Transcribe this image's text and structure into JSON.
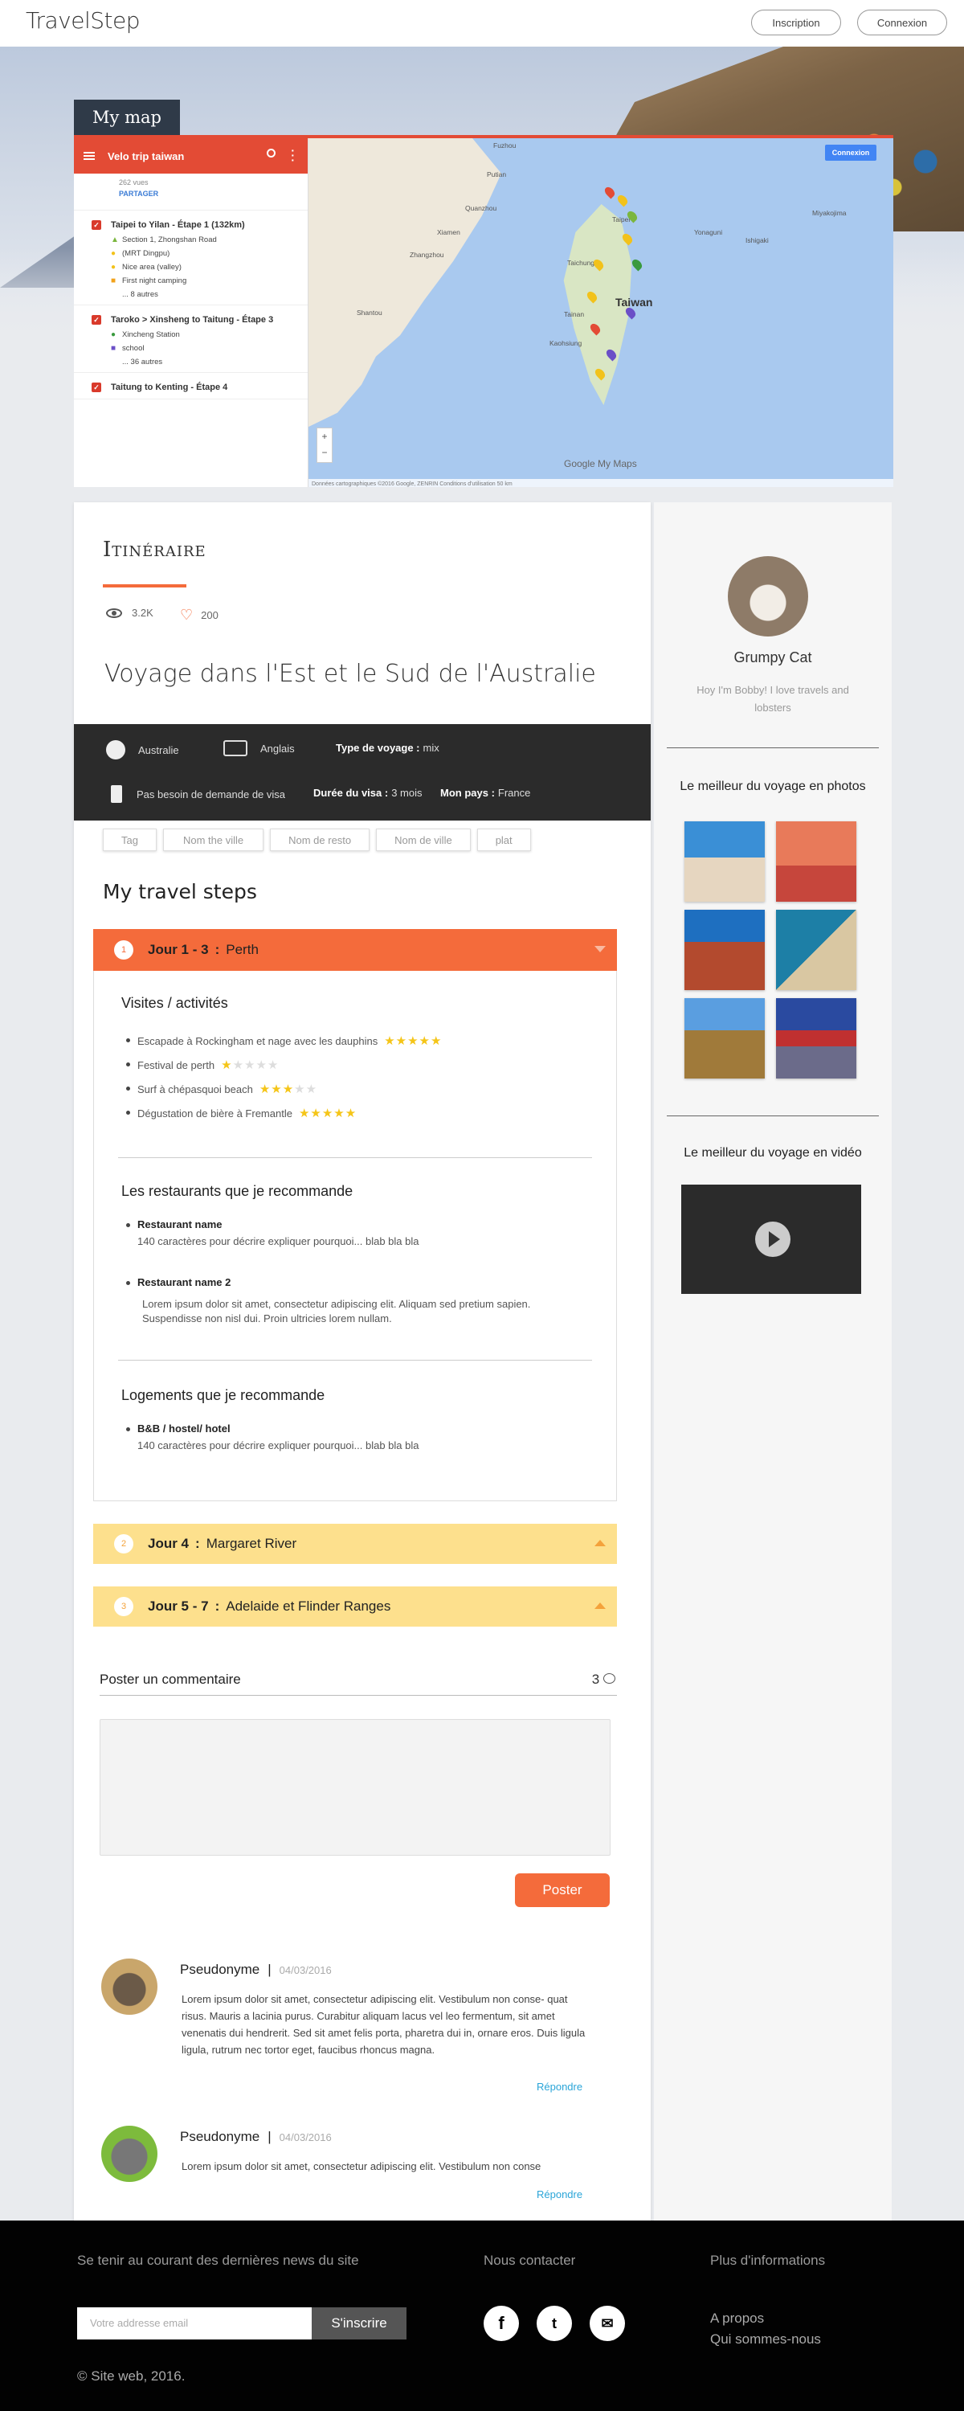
{
  "header": {
    "logo": "TravelStep",
    "signup": "Inscription",
    "login": "Connexion"
  },
  "map": {
    "tab_label": "My map",
    "title": "Velo trip taiwan",
    "views": "262 vues",
    "share": "PARTAGER",
    "connect_label": "Connexion",
    "footer_text": "Données cartographiques ©2016 Google, ZENRIN   Conditions d'utilisation   50 km",
    "brand": "Google My Maps",
    "layers": [
      {
        "title": "Taipei to Yilan - Étape 1 (132km)",
        "items": [
          "Section 1, Zhongshan Road",
          "(MRT Dingpu)",
          "Nice area (valley)",
          "First night camping",
          "... 8 autres"
        ]
      },
      {
        "title": "Taroko > Xinsheng to Taitung - Étape 3",
        "items": [
          "Xincheng Station",
          "school",
          "... 36 autres"
        ]
      },
      {
        "title": "Taitung to Kenting - Étape 4",
        "items": []
      }
    ],
    "places": [
      "Fuzhou",
      "Putian",
      "Quanzhou",
      "Xiamen",
      "Zhangzhou",
      "Shantou",
      "Taipei",
      "Taichung",
      "Tainan",
      "Kaohsiung",
      "Taiwan",
      "Miyakojima",
      "Ishigaki",
      "Yonaguni"
    ]
  },
  "itinerary": {
    "heading": "Itinéraire",
    "views": "3.2K",
    "likes": "200",
    "title": "Voyage dans l'Est et le Sud de l'Australie",
    "country": "Australie",
    "language": "Anglais",
    "trip_type_label": "Type de voyage :",
    "trip_type": "mix",
    "visa": "Pas besoin de demande de visa",
    "visa_duration_label": "Durée du visa :",
    "visa_duration": "3 mois",
    "home_label": "Mon pays :",
    "home": "France",
    "tags": [
      "Tag",
      "Nom the ville",
      "Nom de resto",
      "Nom de ville",
      "plat"
    ]
  },
  "steps": {
    "heading": "My travel steps",
    "items": [
      {
        "num": "1",
        "days": "Jour 1 - 3",
        "sep": ":",
        "place": "Perth"
      },
      {
        "num": "2",
        "days": "Jour 4",
        "sep": ":",
        "place": "Margaret River"
      },
      {
        "num": "3",
        "days": "Jour 5 - 7",
        "sep": ":",
        "place": "Adelaide et Flinder Ranges"
      }
    ],
    "activities_heading": "Visites / activités",
    "activities": [
      {
        "label": "Escapade à Rockingham et nage avec les dauphins",
        "rating": 5
      },
      {
        "label": "Festival de perth",
        "rating": 1
      },
      {
        "label": "Surf à chépasquoi beach",
        "rating": 3
      },
      {
        "label": "Dégustation de bière à Fremantle",
        "rating": 5
      }
    ],
    "restaurants_heading": "Les restaurants que je recommande",
    "restaurants": [
      {
        "name": "Restaurant name",
        "desc": "140 caractères pour décrire expliquer pourquoi... blab bla bla"
      },
      {
        "name": "Restaurant name 2",
        "desc": "Lorem ipsum dolor sit amet, consectetur adipiscing elit. Aliquam sed pretium sapien. Suspendisse non nisl dui. Proin ultricies lorem nullam."
      }
    ],
    "lodging_heading": "Logements que je recommande",
    "lodging": {
      "name": "B&B / hostel/ hotel",
      "desc": "140 caractères pour décrire expliquer pourquoi... blab bla bla"
    }
  },
  "comments": {
    "heading": "Poster un commentaire",
    "count": "3",
    "post_label": "Poster",
    "reply_label": "Répondre",
    "items": [
      {
        "user": "Pseudonyme",
        "date": "04/03/2016",
        "text": "Lorem ipsum dolor sit amet, consectetur adipiscing elit. Vestibulum non conse- quat risus. Mauris a lacinia purus. Curabitur aliquam lacus vel leo fermentum, sit amet venenatis dui hendrerit. Sed sit amet felis porta, pharetra dui in, ornare eros. Duis ligula ligula, rutrum nec tortor eget, faucibus rhoncus magna."
      },
      {
        "user": "Pseudonyme",
        "date": "04/03/2016",
        "text": "Lorem ipsum dolor sit amet, consectetur adipiscing elit. Vestibulum non conse"
      }
    ]
  },
  "sidebar": {
    "name": "Grumpy Cat",
    "bio": "Hoy I'm Bobby! I love travels and lobsters",
    "photos_heading": "Le meilleur du voyage en photos",
    "video_heading": "Le meilleur du voyage en vidéo"
  },
  "footer": {
    "news_heading": "Se tenir au courant des dernières news du site",
    "email_placeholder": "Votre addresse email",
    "subscribe": "S'inscrire",
    "contact_heading": "Nous contacter",
    "more_heading": "Plus d'informations",
    "links": [
      "A propos",
      "Qui sommes-nous"
    ],
    "copyright": "© Site web, 2016."
  }
}
